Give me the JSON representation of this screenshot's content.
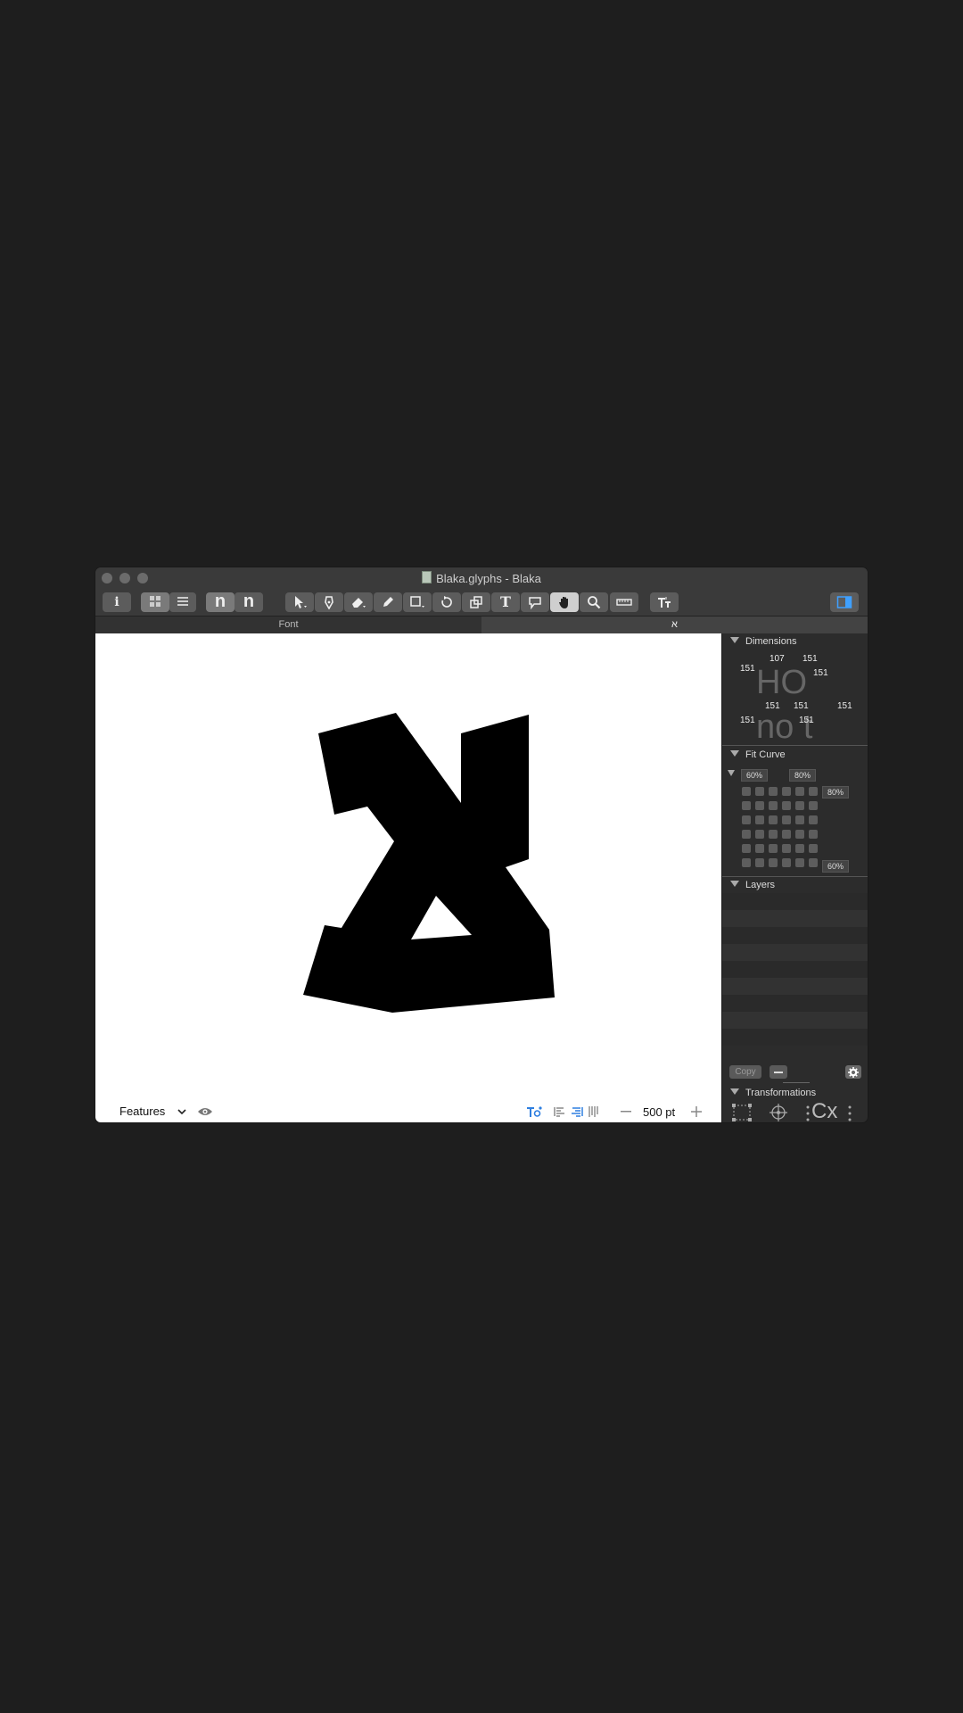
{
  "window": {
    "title": "Blaka.glyphs - Blaka"
  },
  "toolbar": {
    "info_label": "i",
    "font_n_label_1": "n",
    "font_n_label_2": "n",
    "text_tool_label": "T"
  },
  "tabs": [
    {
      "label": "Font"
    },
    {
      "label": "א"
    }
  ],
  "bottom": {
    "features_label": "Features",
    "font_size": "500 pt"
  },
  "panel": {
    "dimensions": {
      "title": "Dimensions",
      "top_values": [
        "151",
        "107",
        "151",
        "151"
      ],
      "bottom_values": [
        "151",
        "151",
        "151",
        "151",
        "151"
      ],
      "ghost_upper": "HO",
      "ghost_lower": "no  t"
    },
    "fit_curve": {
      "title": "Fit Curve",
      "top_left_value": "60%",
      "top_right_value": "80%",
      "right_top_value": "80%",
      "right_bottom_value": "60%"
    },
    "layers": {
      "title": "Layers",
      "copy_label": "Copy"
    },
    "transformations": {
      "title": "Transformations",
      "cx_label": "Cx"
    }
  },
  "colors": {
    "accent": "#2f7fe0",
    "canvas": "#ffffff",
    "chrome": "#3a3a3a"
  }
}
